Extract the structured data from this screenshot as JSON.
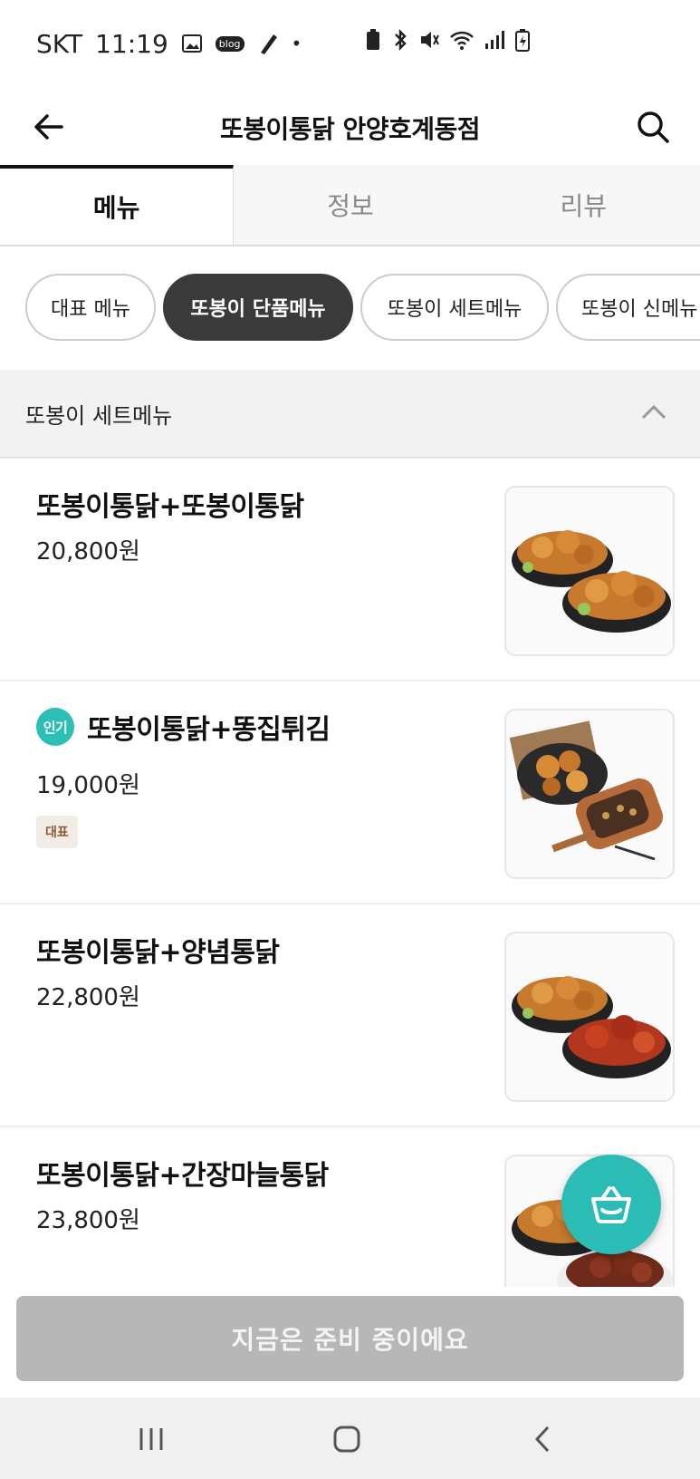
{
  "status_bar": {
    "carrier": "SKT",
    "time": "11:19",
    "left_icons": [
      "image-icon",
      "blog-icon",
      "pen-icon",
      "dot-icon"
    ],
    "right_icons": [
      "battery-saver-icon",
      "bluetooth-icon",
      "mute-icon",
      "wifi-icon",
      "signal-icon",
      "battery-icon"
    ],
    "blog_label": "blog"
  },
  "appbar": {
    "title": "또봉이통닭 안양호계동점",
    "back_icon": "arrow-left-icon",
    "search_icon": "search-icon"
  },
  "tabs": [
    {
      "label": "메뉴",
      "active": true
    },
    {
      "label": "정보",
      "active": false
    },
    {
      "label": "리뷰",
      "active": false
    }
  ],
  "chips": [
    {
      "label": "대표 메뉴",
      "active": false
    },
    {
      "label": "또봉이 단품메뉴",
      "active": true
    },
    {
      "label": "또봉이 세트메뉴",
      "active": false
    },
    {
      "label": "또봉이 신메뉴",
      "active": false
    }
  ],
  "section": {
    "title": "또봉이 세트메뉴",
    "icon": "chevron-up-icon"
  },
  "items": [
    {
      "name": "또봉이통닭+또봉이통닭",
      "price": "20,800원",
      "hot_badge": "",
      "tag": ""
    },
    {
      "name": "또봉이통닭+똥집튀김",
      "price": "19,000원",
      "hot_badge": "인기",
      "tag": "대표"
    },
    {
      "name": "또봉이통닭+양념통닭",
      "price": "22,800원",
      "hot_badge": "",
      "tag": ""
    },
    {
      "name": "또봉이통닭+간장마늘통닭",
      "price": "23,800원",
      "hot_badge": "",
      "tag": ""
    }
  ],
  "fab": {
    "icon": "basket-icon"
  },
  "cta": {
    "label": "지금은 준비 중이에요"
  },
  "navbar": {
    "icons": [
      "recent-apps-icon",
      "home-icon",
      "back-icon"
    ]
  },
  "colors": {
    "accent": "#2bbdb5",
    "chip_active": "#3a3a3a",
    "cta_disabled": "#b7b7b7"
  }
}
